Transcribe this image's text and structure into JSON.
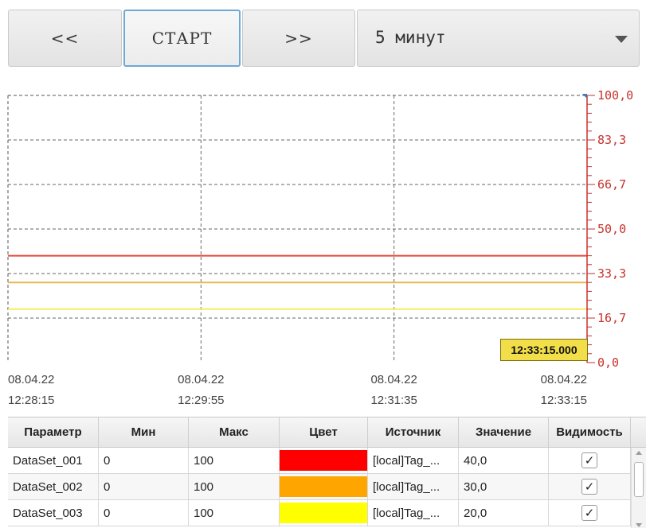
{
  "toolbar": {
    "prev_label": "<<",
    "start_label": "СТАРТ",
    "next_label": ">>",
    "period_value": "5 минут"
  },
  "chart_data": {
    "type": "line",
    "y_axis": {
      "range": [
        0,
        100
      ],
      "tick_labels": [
        "100,0",
        "83,3",
        "66,7",
        "50,0",
        "33,3",
        "16,7",
        "0,0"
      ],
      "position": "right",
      "color": "#c8322c"
    },
    "x_axis": {
      "tick_labels": [
        {
          "date": "08.04.22",
          "time": "12:28:15"
        },
        {
          "date": "08.04.22",
          "time": "12:29:55"
        },
        {
          "date": "08.04.22",
          "time": "12:31:35"
        },
        {
          "date": "08.04.22",
          "time": "12:33:15"
        }
      ]
    },
    "grid": true,
    "series": [
      {
        "values": [
          40,
          40
        ],
        "color": "#e8473c"
      },
      {
        "values": [
          30,
          30
        ],
        "color": "#e9b84a"
      },
      {
        "values": [
          20,
          20
        ],
        "color": "#f5ee5a"
      }
    ],
    "cursor_label": "12:33:15.000"
  },
  "table": {
    "headers": [
      "Параметр",
      "Мин",
      "Макс",
      "Цвет",
      "Источник",
      "Значение",
      "Видимость"
    ],
    "rows": [
      {
        "param": "DataSet_001",
        "min": "0",
        "max": "100",
        "color": "#ff0000",
        "source": "[local]Tag_...",
        "value": "40,0",
        "visible": "✓"
      },
      {
        "param": "DataSet_002",
        "min": "0",
        "max": "100",
        "color": "#ffa500",
        "source": "[local]Tag_...",
        "value": "30,0",
        "visible": "✓"
      },
      {
        "param": "DataSet_003",
        "min": "0",
        "max": "100",
        "color": "#ffff00",
        "source": "[local]Tag_...",
        "value": "20,0",
        "visible": "✓"
      }
    ]
  }
}
